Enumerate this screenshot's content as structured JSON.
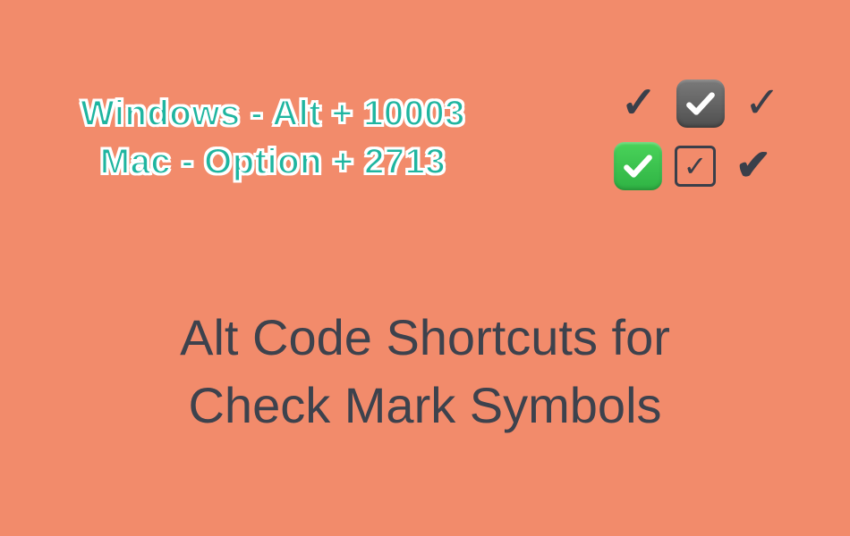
{
  "shortcuts": {
    "windows": "Windows - Alt + 10003",
    "mac": "Mac - Option + 2713"
  },
  "symbols": {
    "row1": {
      "s1": "✓",
      "s3": "✓"
    },
    "row2": {
      "s2": "✓",
      "s3": "✔"
    }
  },
  "heading": {
    "line1": "Alt Code Shortcuts for",
    "line2": "Check Mark Symbols"
  }
}
